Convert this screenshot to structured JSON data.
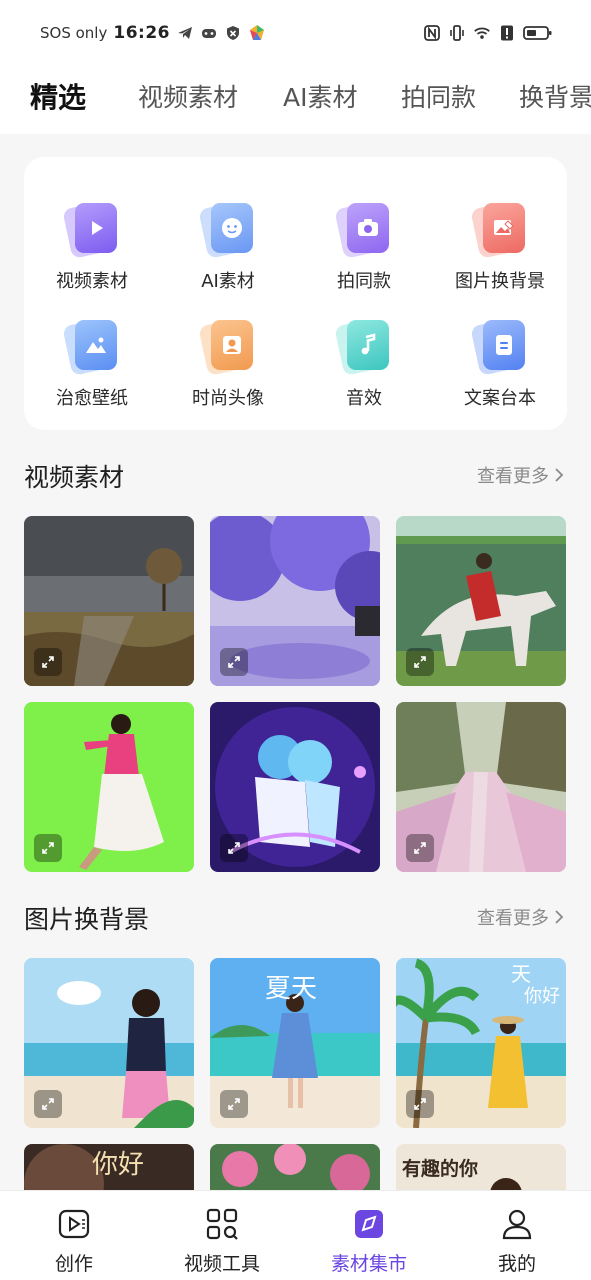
{
  "status_bar": {
    "carrier": "SOS only",
    "time": "16:26"
  },
  "tabs": [
    {
      "label": "精选",
      "active": true
    },
    {
      "label": "视频素材",
      "active": false
    },
    {
      "label": "AI素材",
      "active": false
    },
    {
      "label": "拍同款",
      "active": false
    },
    {
      "label": "换背景",
      "active": false
    }
  ],
  "categories": [
    {
      "label": "视频素材",
      "icon": "play-icon",
      "color": "#8b6cf0"
    },
    {
      "label": "AI素材",
      "icon": "face-icon",
      "color": "#6f9cf5"
    },
    {
      "label": "拍同款",
      "icon": "camera-icon",
      "color": "#9a72f0"
    },
    {
      "label": "图片换背景",
      "icon": "image-edit-icon",
      "color": "#f27a6e"
    },
    {
      "label": "治愈壁纸",
      "icon": "landscape-icon",
      "color": "#5f9cf6"
    },
    {
      "label": "时尚头像",
      "icon": "person-icon",
      "color": "#f5a25d"
    },
    {
      "label": "音效",
      "icon": "music-note-icon",
      "color": "#4ed4cc"
    },
    {
      "label": "文案台本",
      "icon": "document-icon",
      "color": "#5d8ff5"
    }
  ],
  "sections": {
    "video": {
      "title": "视频素材",
      "more": "查看更多"
    },
    "background": {
      "title": "图片换背景",
      "more": "查看更多"
    }
  },
  "thumb_text": {
    "summer": "夏天",
    "hello_1": "天",
    "hello_2": "你好",
    "fun": "有趣的你",
    "nihao": "你好"
  },
  "bottom_nav": [
    {
      "label": "创作",
      "icon": "create-icon",
      "active": false
    },
    {
      "label": "视频工具",
      "icon": "video-tools-icon",
      "active": false
    },
    {
      "label": "素材集市",
      "icon": "market-icon",
      "active": true
    },
    {
      "label": "我的",
      "icon": "profile-icon",
      "active": false
    }
  ],
  "colors": {
    "accent": "#6b46e0",
    "background": "#f6f6f7"
  }
}
